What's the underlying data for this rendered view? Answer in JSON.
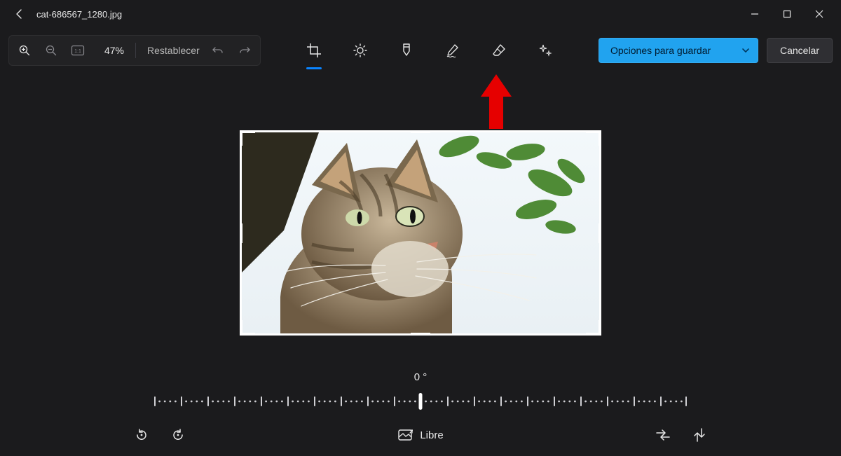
{
  "titlebar": {
    "filename": "cat-686567_1280.jpg"
  },
  "toolbar": {
    "zoom_value": "47%",
    "reset_label": "Restablecer"
  },
  "tools": {
    "crop": "crop",
    "adjust": "adjust",
    "marker": "marker",
    "draw": "draw",
    "erase": "erase",
    "retouch": "retouch",
    "active": "crop"
  },
  "actions": {
    "save_options_label": "Opciones para guardar",
    "cancel_label": "Cancelar"
  },
  "crop": {
    "rotation_label": "0 °",
    "aspect_label": "Libre"
  },
  "colors": {
    "accent": "#0a84ff",
    "save_button": "#21a3ef",
    "annotation_arrow": "#e60000"
  }
}
